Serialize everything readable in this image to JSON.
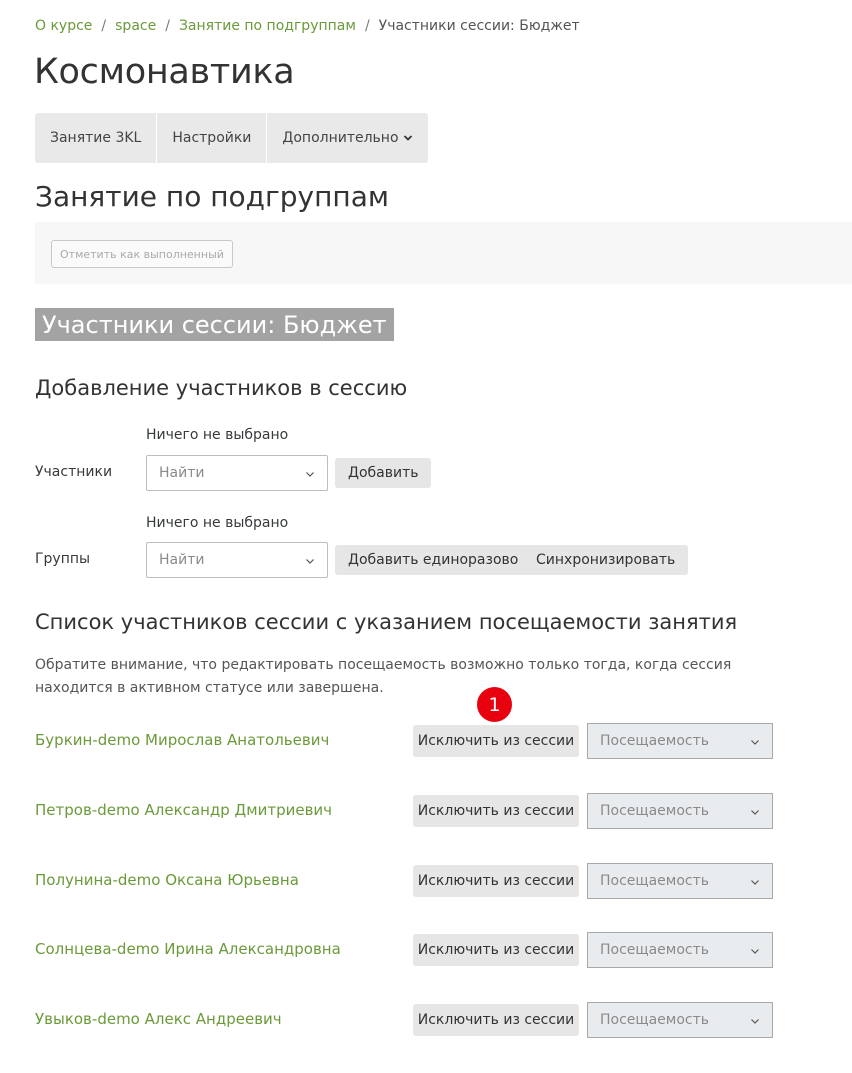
{
  "breadcrumb": {
    "items": [
      "О курсе",
      "space",
      "Занятие по подгруппам"
    ],
    "current": "Участники сессии: Бюджет",
    "separator": "/"
  },
  "course_title": "Космонавтика",
  "secondary_nav": {
    "items": [
      "Занятие 3KL",
      "Настройки",
      "Дополнительно"
    ]
  },
  "activity_title": "Занятие по подгруппам",
  "completion": {
    "button_label": "Отметить как выполненный"
  },
  "session_heading": "Участники сессии: Бюджет",
  "add_section": {
    "heading": "Добавление участников в сессию",
    "participants": {
      "label": "Участники",
      "none_selected": "Ничего не выбрано",
      "placeholder": "Найти",
      "add_button": "Добавить"
    },
    "groups": {
      "label": "Группы",
      "none_selected": "Ничего не выбрано",
      "placeholder": "Найти",
      "add_once_button": "Добавить единоразово",
      "sync_button": "Синхронизировать"
    }
  },
  "list_section": {
    "heading": "Список участников сессии с указанием посещаемости занятия",
    "note": "Обратите внимание, что редактировать посещаемость возможно только тогда, когда сессия находится в активном статусе или завершена.",
    "badge": "1",
    "exclude_label": "Исключить из сессии",
    "attendance_placeholder": "Посещаемость",
    "participants": [
      "Буркин-demo Мирослав Анатольевич",
      "Петров-demo Александр Дмитриевич",
      "Полунина-demo Оксана Юрьевна",
      "Солнцева-demo Ирина Александровна",
      "Увыков-demo Алекс Андреевич"
    ]
  },
  "colors": {
    "link": "#6b9a3a",
    "badge": "#e8000f",
    "heading_bg": "#a3a3a3"
  },
  "icons": {
    "dropdown": "chevron-down-icon"
  }
}
